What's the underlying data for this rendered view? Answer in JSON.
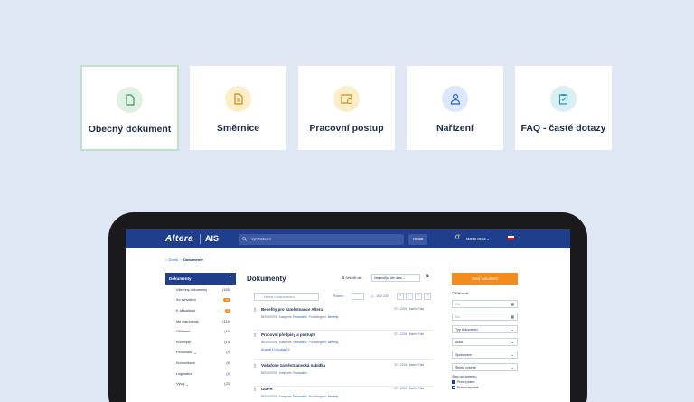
{
  "cards": [
    {
      "label": "Obecný dokument",
      "icon": "document-icon",
      "color": "#dff1e4",
      "selected": true
    },
    {
      "label": "Směrnice",
      "icon": "directive-icon",
      "color": "#fbeec8"
    },
    {
      "label": "Pracovní postup",
      "icon": "workflow-icon",
      "color": "#fbeec8"
    },
    {
      "label": "Nařízení",
      "icon": "person-icon",
      "color": "#dbe8fb"
    },
    {
      "label": "FAQ - časté dotazy",
      "icon": "clipboard-icon",
      "color": "#d8f0f2"
    }
  ],
  "app": {
    "logo": "Altera",
    "product": "AIS",
    "search_placeholder": "Vyhledávání",
    "search_button": "Hledat",
    "user_name": "Martin Musil"
  },
  "breadcrumb": {
    "home": "Domů",
    "current": "Dokumenty"
  },
  "sidebar": {
    "title": "Dokumenty",
    "items": [
      {
        "label": "Všechny dokumenty",
        "count": "(155)"
      },
      {
        "label": "Ke schválení",
        "badge": "12"
      },
      {
        "label": "K aktualizaci",
        "badge": "3"
      },
      {
        "label": "Mé dokumenty",
        "count": "(115)"
      },
      {
        "label": "Oblíbené",
        "count": "(15)"
      },
      {
        "label": "Koncepty",
        "count": "(19)"
      },
      {
        "label": "Personální",
        "count": "(3)"
      },
      {
        "label": "Komunikace",
        "count": "(6)"
      },
      {
        "label": "Legislativa",
        "count": "(4)"
      },
      {
        "label": "Vývoj",
        "count": "(23)"
      }
    ]
  },
  "main": {
    "title": "Dokumenty",
    "sort_label": "Seřadit dle:",
    "sort_value": "Nejnovější dle data",
    "search_placeholder": "Hledat v dokumentech",
    "razeni": "Řazení",
    "range": "1 - 10 z 230",
    "docs": [
      {
        "title": "Benefity pro zaměstnance Altera",
        "meta_id": "BEN000976",
        "category": "Personální",
        "subcategory": "Benefity",
        "date": "27.1.2024",
        "author": "Martin Pala",
        "count": "7"
      },
      {
        "title": "Pracovní předpisy a postupy",
        "meta_id": "BEN000976",
        "category": "Personální",
        "subcategory": "Benefity",
        "date": "27.1.2024",
        "author": "Martin Pala",
        "count": "7",
        "tags": "Acrobat 10  Acrobat 10"
      },
      {
        "title": "Vodafone zaměstnanecká nabídka",
        "meta_id": "BEN000976",
        "category": "Personální",
        "subcategory": "",
        "date": "27.1.2024",
        "author": "Martin Pala",
        "count": "7"
      },
      {
        "title": "GDPR",
        "meta_id": "BEN000976",
        "category": "Personální",
        "subcategory": "Benefity",
        "date": "27.1.2024",
        "author": "Martin Pala",
        "count": "7"
      }
    ]
  },
  "right": {
    "new_button": "Nový dokument",
    "filter_title": "Filtrovat",
    "od": "Od",
    "do": "Do",
    "typ": "Typ dokumentu",
    "autor": "Autor",
    "spolupracovnik": "Spolupráce",
    "stitek": "Štítek: vyberte",
    "stav_title": "Stav dokumentu",
    "checks": [
      "Prošel platné",
      "Prošel neplatné"
    ]
  }
}
